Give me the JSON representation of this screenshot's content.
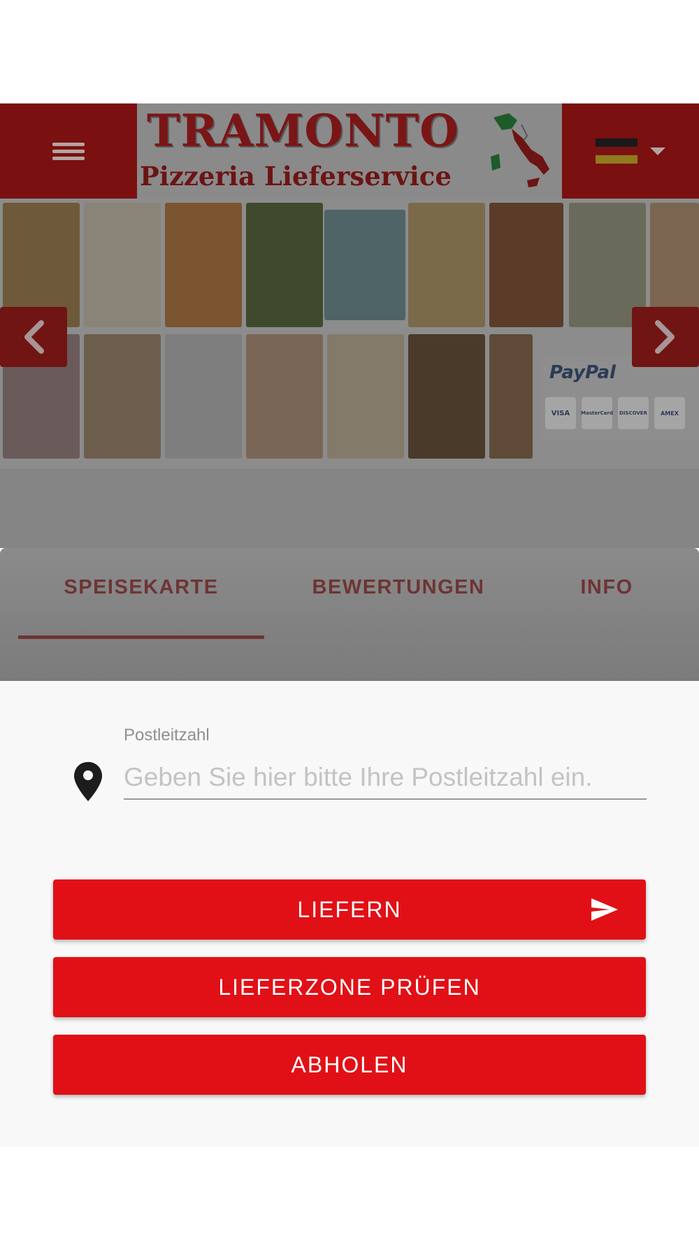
{
  "header": {
    "menu_icon": "hamburger-menu-icon",
    "logo": {
      "title": "TRAMONTO",
      "subtitle": "Pizzeria Lieferservice"
    },
    "language_flag": "germany-flag-icon",
    "language_caret": "caret-down-icon"
  },
  "gallery": {
    "prev_icon": "chevron-left-icon",
    "next_icon": "chevron-right-icon",
    "payment": {
      "brand": "PayPal",
      "cards": [
        "VISA",
        "MasterCard",
        "DISCOVER",
        "AMEX"
      ]
    }
  },
  "tabs": [
    {
      "label": "SPEISEKARTE",
      "active": true
    },
    {
      "label": "BEWERTUNGEN",
      "active": false
    },
    {
      "label": "INFO",
      "active": false
    }
  ],
  "delivery": {
    "zip_label": "Postleitzahl",
    "zip_placeholder": "Geben Sie hier bitte Ihre Postleitzahl ein.",
    "zip_value": "",
    "location_icon": "location-pin-icon",
    "buttons": {
      "deliver": "LIEFERN",
      "deliver_icon": "send-icon",
      "check_zone": "LIEFERZONE PRÜFEN",
      "pickup": "ABHOLEN"
    }
  },
  "colors": {
    "header_bg": "#7a1010",
    "primary_button": "#e11016",
    "tab_text": "#6e3434",
    "sheet_bg": "#f8f8f8"
  }
}
